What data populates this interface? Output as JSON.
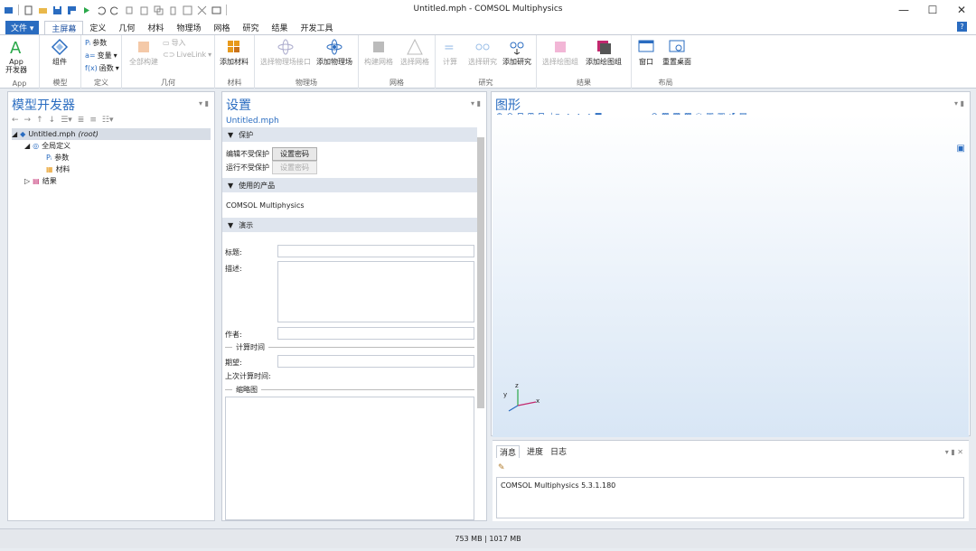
{
  "window": {
    "title": "Untitled.mph - COMSOL Multiphysics",
    "minimize": "—",
    "maximize": "☐",
    "close": "✕"
  },
  "menu": {
    "file": "文件 ▾",
    "tabs": [
      "主屏幕",
      "定义",
      "几何",
      "材料",
      "物理场",
      "网格",
      "研究",
      "结果",
      "开发工具"
    ],
    "help": "?"
  },
  "ribbon": {
    "app_builder": "App\n开发器",
    "app_group": "App",
    "component": "组件",
    "model_group": "模型",
    "parameters": "参数",
    "variables": "变量",
    "functions": "函数",
    "def_group": "定义",
    "build_all": "全部构建",
    "import": "导入",
    "livelink": "LiveLink",
    "geom_group": "几何",
    "add_material": "添加材料",
    "mat_group": "材料",
    "select_physics": "选择物理场接口",
    "add_physics": "添加物理场",
    "phys_group": "物理场",
    "build_mesh": "构建网格",
    "select_mesh": "选择网格",
    "mesh_group": "网格",
    "compute": "计算",
    "select_study": "选择研究",
    "add_study": "添加研究",
    "study_group": "研究",
    "select_plot": "选择绘图组",
    "add_plot": "添加绘图组",
    "results_group": "结果",
    "windows": "窗口",
    "reset_desktop": "重置桌面",
    "layout_group": "布局"
  },
  "model_builder": {
    "title": "模型开发器",
    "tree": {
      "root": "Untitled.mph",
      "root_suffix": "(root)",
      "global_defs": "全局定义",
      "params": "参数",
      "materials": "材料",
      "results": "结果"
    }
  },
  "settings": {
    "title": "设置",
    "subtitle": "Untitled.mph",
    "protection": "保护",
    "edit_unprotected": "编辑不受保护",
    "run_unprotected": "运行不受保护",
    "set_password": "设置密码",
    "products_used": "使用的产品",
    "product_name": "COMSOL Multiphysics",
    "presentation": "演示",
    "title_label": "标题:",
    "desc_label": "描述:",
    "author_label": "作者:",
    "compute_time": "计算时间",
    "expected": "期望:",
    "last_compute": "上次计算时间:",
    "thumbnail": "缩略图"
  },
  "graphics": {
    "title": "图形",
    "axis_x": "x",
    "axis_y": "y",
    "axis_z": "z"
  },
  "messages": {
    "tabs": [
      "消息",
      "进度",
      "日志"
    ],
    "content": "COMSOL Multiphysics 5.3.1.180"
  },
  "status": {
    "memory": "753 MB | 1017 MB"
  },
  "colors": {
    "accent": "#2a6cc0",
    "section": "#dfe5ee",
    "orange": "#e89a1c"
  }
}
